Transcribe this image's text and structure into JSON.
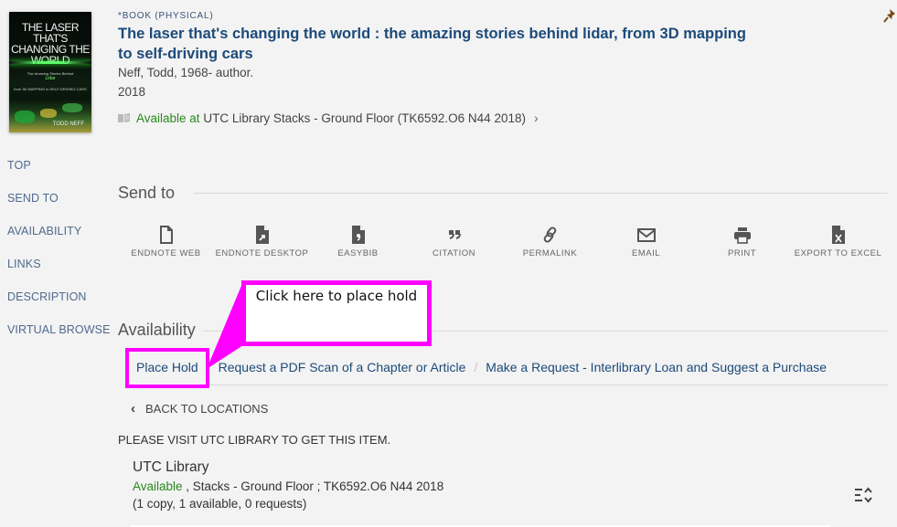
{
  "record": {
    "cover": {
      "title_text": "THE LASER THAT'S CHANGING THE WORLD",
      "subtitle_text": "The Amazing Stories Behind",
      "lidar_text": "Lidar",
      "tagline_text": "from 3D MAPPING to SELF-DRIVING CARS",
      "author_text": "TODD NEFF"
    },
    "type": "*BOOK (PHYSICAL)",
    "title": "The laser that's changing the world : the amazing stories behind lidar, from 3D mapping to self-driving cars",
    "author": "Neff, Todd, 1968- author.",
    "year": "2018",
    "availability": {
      "status": "Available at",
      "location": "UTC Library  Stacks - Ground Floor (TK6592.O6 N44 2018)"
    }
  },
  "sidenav": {
    "items": [
      {
        "label": "TOP"
      },
      {
        "label": "SEND TO"
      },
      {
        "label": "AVAILABILITY"
      },
      {
        "label": "LINKS"
      },
      {
        "label": "DESCRIPTION"
      },
      {
        "label": "VIRTUAL BROWSE"
      }
    ]
  },
  "send_to": {
    "heading": "Send to",
    "actions": [
      {
        "label": "ENDNOTE WEB",
        "icon": "file-icon"
      },
      {
        "label": "ENDNOTE DESKTOP",
        "icon": "file-export-icon"
      },
      {
        "label": "EASYBIB",
        "icon": "file-comma-icon"
      },
      {
        "label": "CITATION",
        "icon": "quote-icon"
      },
      {
        "label": "PERMALINK",
        "icon": "link-icon"
      },
      {
        "label": "EMAIL",
        "icon": "envelope-icon"
      },
      {
        "label": "PRINT",
        "icon": "printer-icon"
      },
      {
        "label": "EXPORT TO EXCEL",
        "icon": "excel-file-icon"
      }
    ]
  },
  "availability_section": {
    "heading": "Availability",
    "request_links": [
      {
        "label": "Place Hold"
      },
      {
        "label": "Request a PDF Scan of a Chapter or Article"
      },
      {
        "label": "Make a Request - Interlibrary Loan and Suggest a Purchase"
      }
    ],
    "back_label": "BACK TO LOCATIONS",
    "notice": "PLEASE VISIT UTC LIBRARY TO GET THIS ITEM.",
    "location": {
      "name": "UTC Library",
      "status": "Available",
      "detail": " , Stacks - Ground Floor ; TK6592.O6 N44 2018",
      "counts": "(1 copy, 1 available, 0 requests)"
    }
  },
  "annotation": {
    "callout_text": "Click here to place hold",
    "color": "#ff00ff"
  },
  "colors": {
    "background": "#f3f3f3",
    "link": "#1c4a7a",
    "available": "#2b8a1e",
    "nav": "#4f6a8e"
  }
}
